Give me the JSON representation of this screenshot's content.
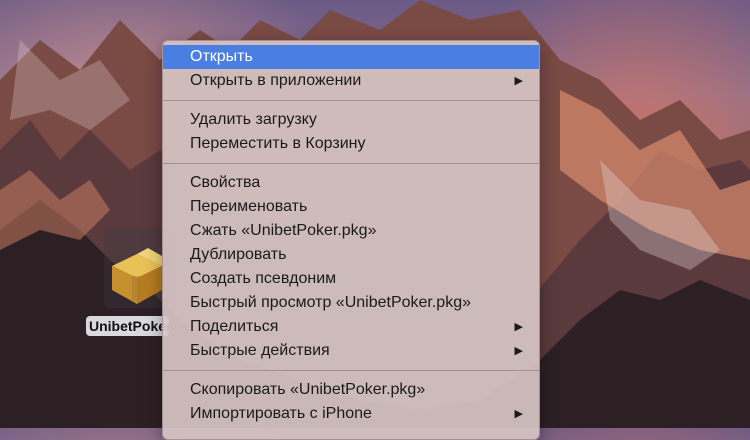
{
  "desktop": {
    "file_label": "UnibetPoker.pkg"
  },
  "menu": {
    "groups": [
      [
        {
          "label": "Открыть",
          "submenu": false,
          "highlighted": true
        },
        {
          "label": "Открыть в приложении",
          "submenu": true
        }
      ],
      [
        {
          "label": "Удалить загрузку",
          "submenu": false
        },
        {
          "label": "Переместить в Корзину",
          "submenu": false
        }
      ],
      [
        {
          "label": "Свойства",
          "submenu": false
        },
        {
          "label": "Переименовать",
          "submenu": false
        },
        {
          "label": "Сжать «UnibetPoker.pkg»",
          "submenu": false
        },
        {
          "label": "Дублировать",
          "submenu": false
        },
        {
          "label": "Создать псевдоним",
          "submenu": false
        },
        {
          "label": "Быстрый просмотр «UnibetPoker.pkg»",
          "submenu": false
        },
        {
          "label": "Поделиться",
          "submenu": true
        },
        {
          "label": "Быстрые действия",
          "submenu": true
        }
      ],
      [
        {
          "label": "Скопировать «UnibetPoker.pkg»",
          "submenu": false
        },
        {
          "label": "Импортировать с iPhone",
          "submenu": true
        }
      ]
    ],
    "submenu_arrow": "▶",
    "highlight_color": "#4a7ee0"
  }
}
